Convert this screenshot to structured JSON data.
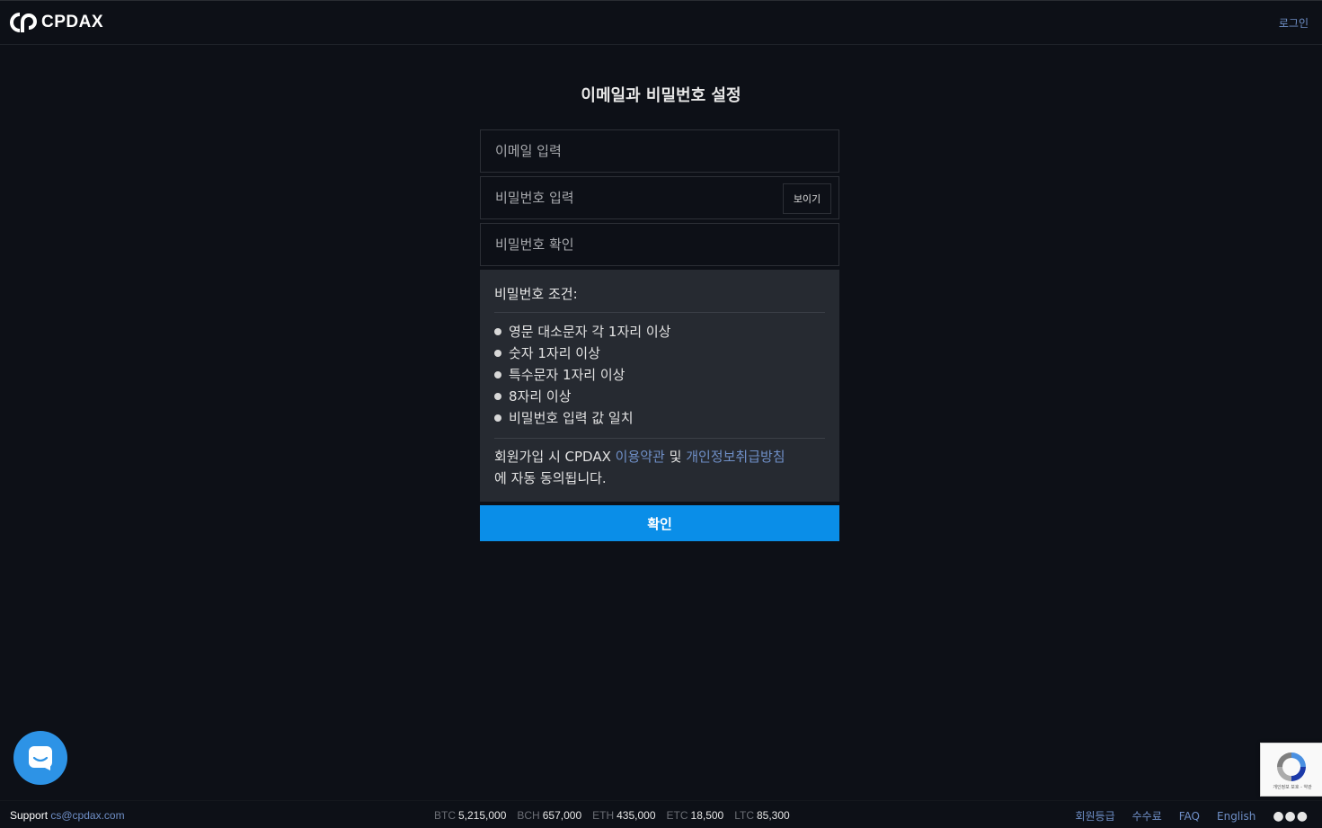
{
  "header": {
    "logo_text": "CPDAX",
    "login_label": "로그인"
  },
  "main": {
    "title": "이메일과 비밀번호 설정",
    "email_placeholder": "이메일 입력",
    "password_placeholder": "비밀번호 입력",
    "show_label": "보이기",
    "confirm_placeholder": "비밀번호 확인",
    "conditions_title": "비밀번호 조건:",
    "conditions": [
      "영문 대소문자 각 1자리 이상",
      "숫자 1자리 이상",
      "특수문자 1자리 이상",
      "8자리 이상",
      "비밀번호 입력 값 일치"
    ],
    "agree_prefix": "회원가입 시 CPDAX ",
    "terms_link": "이용약관",
    "agree_and": " 및 ",
    "privacy_link": "개인정보취급방침",
    "agree_suffix": "에 자동 동의됩니다.",
    "submit_label": "확인"
  },
  "recaptcha": {
    "text": "개인정보 보호 - 약관"
  },
  "footer": {
    "support_label": "Support",
    "support_email": "cs@cpdax.com",
    "ticker": [
      {
        "symbol": "BTC",
        "price": "5,215,000"
      },
      {
        "symbol": "BCH",
        "price": "657,000"
      },
      {
        "symbol": "ETH",
        "price": "435,000"
      },
      {
        "symbol": "ETC",
        "price": "18,500"
      },
      {
        "symbol": "LTC",
        "price": "85,300"
      }
    ],
    "links": [
      "회원등급",
      "수수료",
      "FAQ",
      "English"
    ]
  },
  "colors": {
    "background": "#0d1017",
    "accent": "#0a8ee8",
    "link": "#6f8fc7",
    "panel": "#262a31"
  }
}
